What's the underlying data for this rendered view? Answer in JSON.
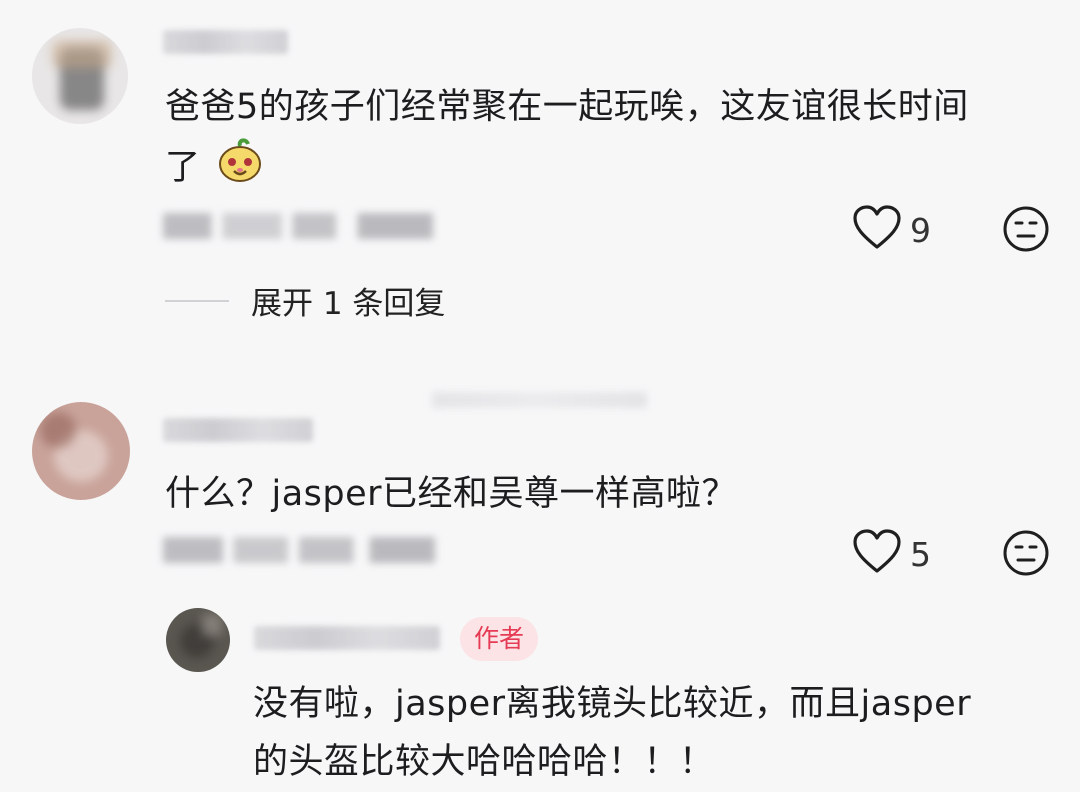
{
  "comments": [
    {
      "text": "爸爸5的孩子们经常聚在一起玩唉，这友谊很长时间了",
      "text_line1": "爸爸5的孩子们经常聚在一起玩唉，这友谊很长时间",
      "text_line2": "了",
      "likes": "9",
      "expand_label": "展开 1 条回复",
      "emoji": "smiling-mascot-emoji"
    },
    {
      "text": "什么？jasper已经和吴尊一样高啦？",
      "likes": "5",
      "reply": {
        "badge": "作者",
        "text_line1": "没有啦，jasper离我镜头比较近，而且jasper",
        "text_line2": "的头盔比较大哈哈哈哈！！！"
      }
    }
  ],
  "icons": {
    "like": "heart-outline-icon",
    "dislike": "neutral-face-icon"
  },
  "colors": {
    "background": "#f7f7f8",
    "badge_bg": "#fbe3e6",
    "badge_text": "#e63b55"
  }
}
